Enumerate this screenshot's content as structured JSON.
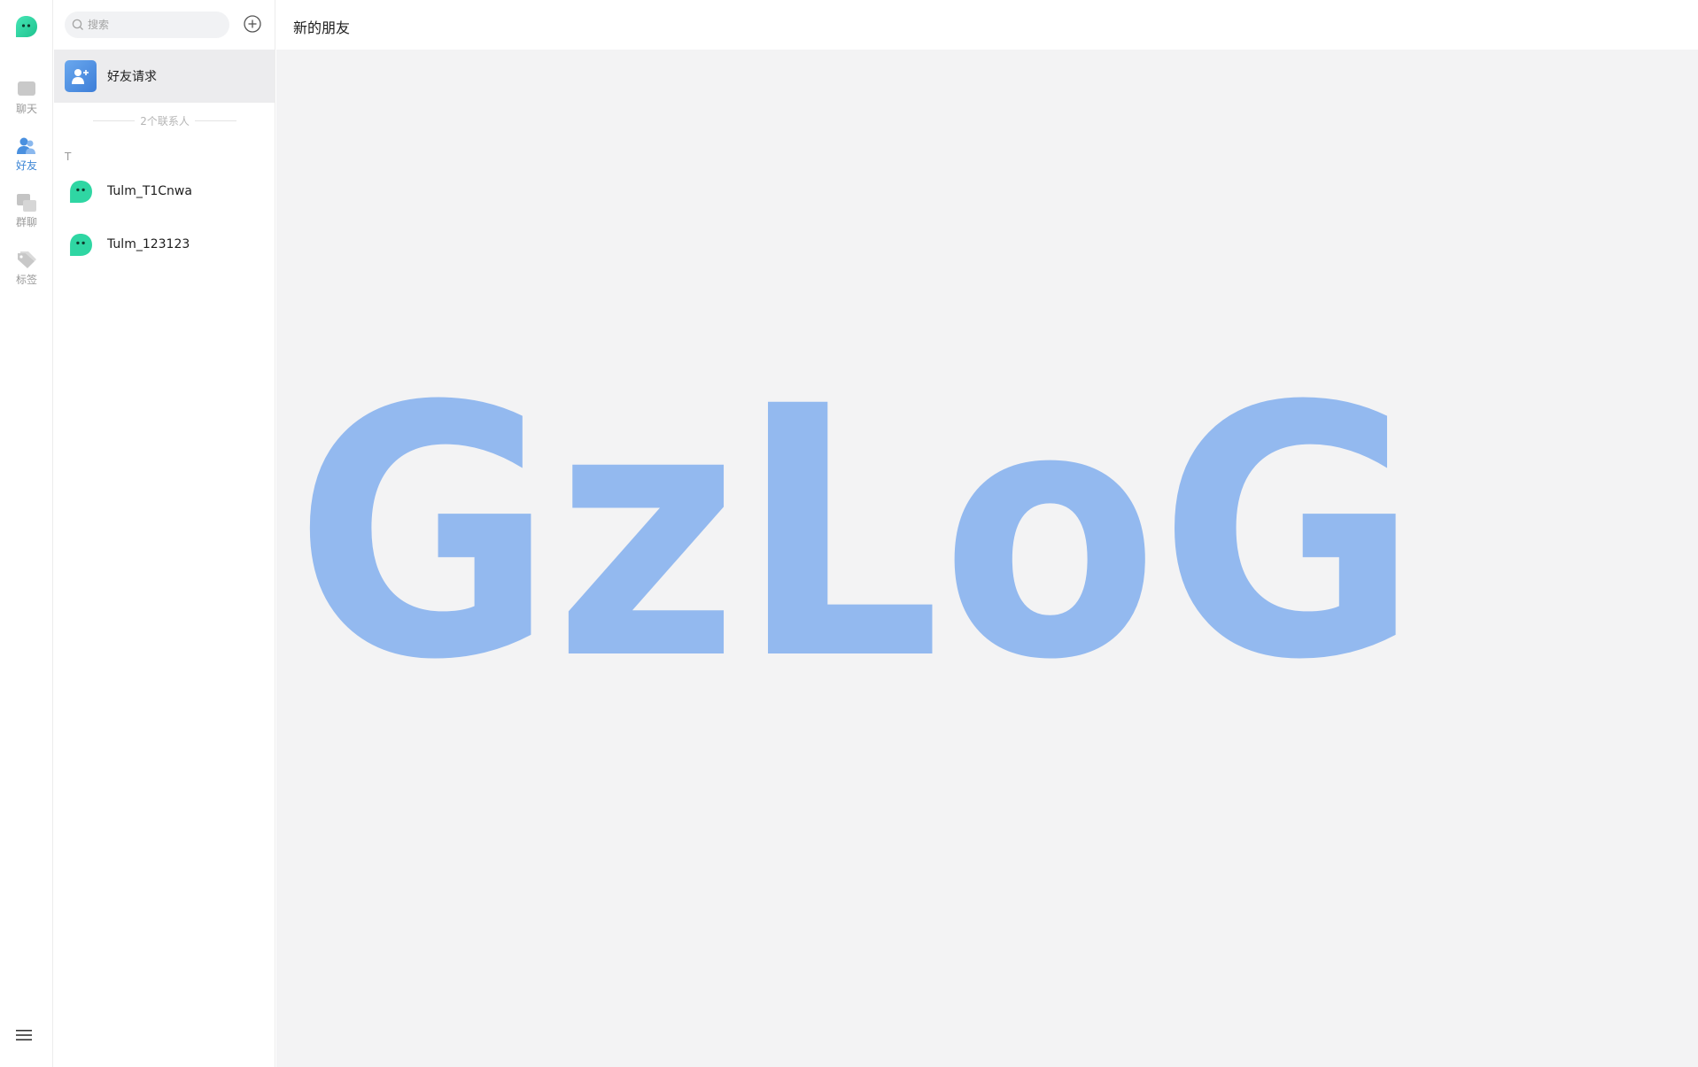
{
  "rail": {
    "items": [
      {
        "label": "聊天",
        "icon": "chat-icon",
        "active": false
      },
      {
        "label": "好友",
        "icon": "friends-icon",
        "active": true
      },
      {
        "label": "群聊",
        "icon": "group-chat-icon",
        "active": false
      },
      {
        "label": "标签",
        "icon": "tag-icon",
        "active": false
      }
    ],
    "menu_icon": "hamburger-menu-icon"
  },
  "contacts": {
    "search_placeholder": "搜索",
    "add_icon": "add-circle-icon",
    "friend_request_label": "好友请求",
    "count_text": "2个联系人",
    "group_letter": "T",
    "list": [
      {
        "name": "Tulm_T1Cnwa"
      },
      {
        "name": "Tulm_123123"
      }
    ]
  },
  "main": {
    "title": "新的朋友",
    "watermark_text": "GzLoG"
  },
  "colors": {
    "accent": "#3d86d6",
    "brand_green": "#2fd6a3",
    "watermark": "#93b9ef",
    "main_bg": "#f3f3f4"
  }
}
